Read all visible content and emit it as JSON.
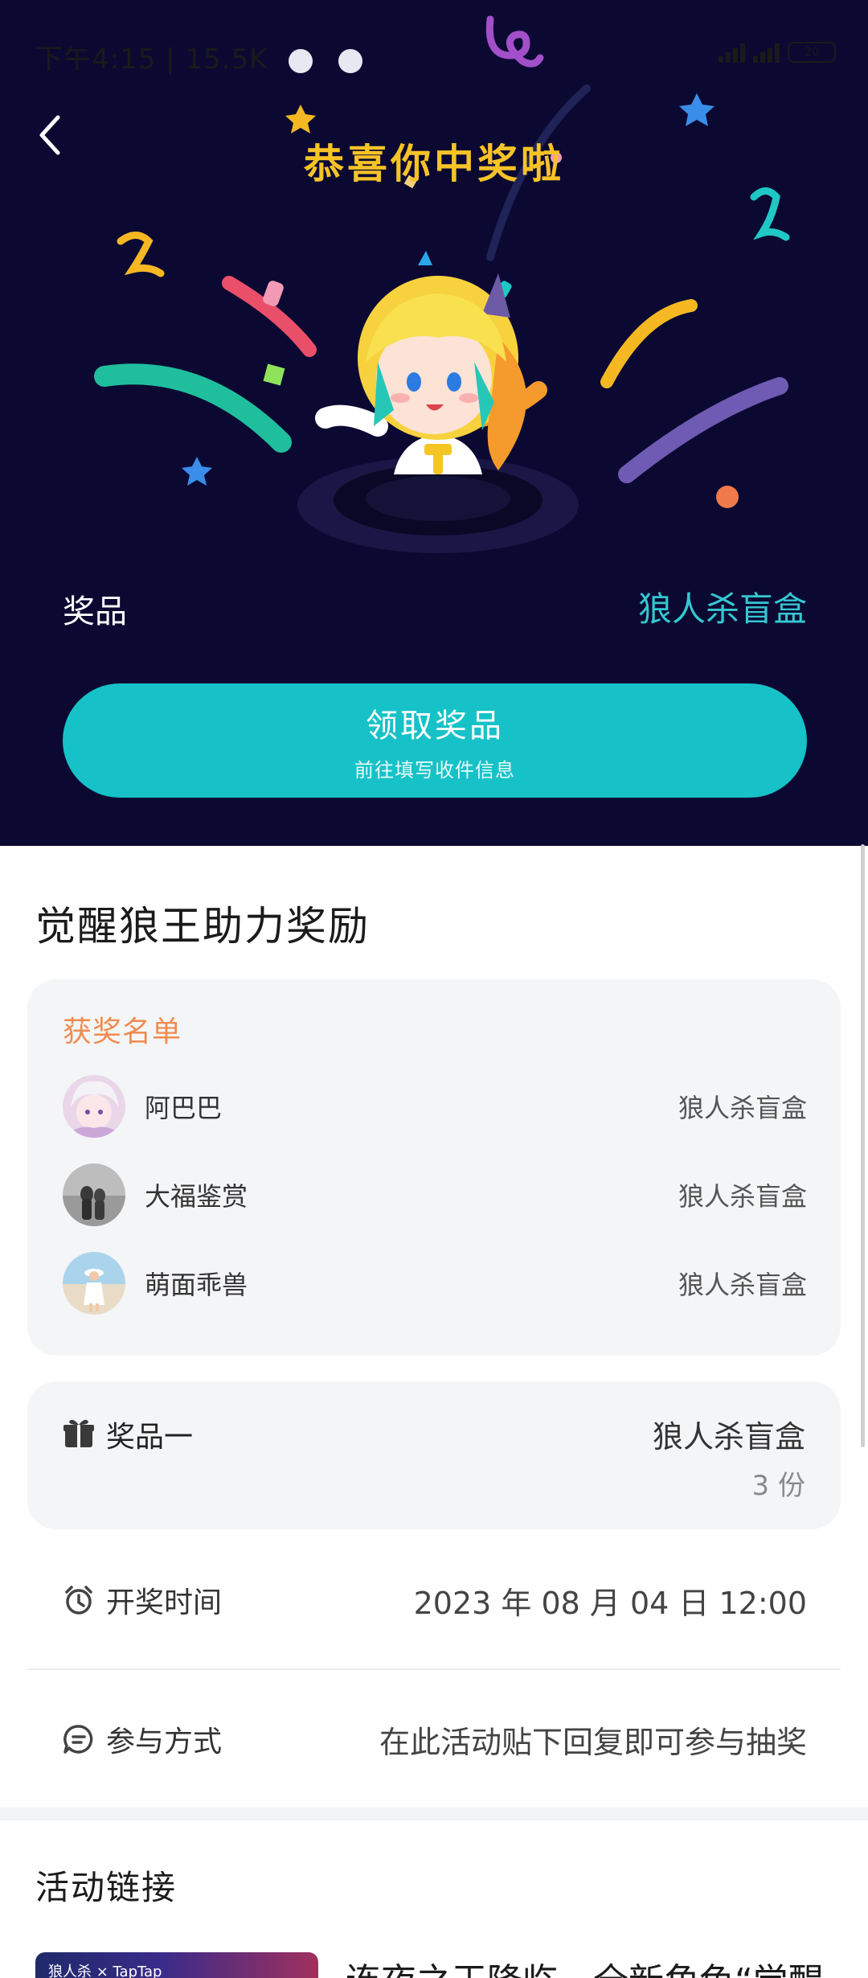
{
  "status_bar": {
    "time": "下午4:15 | 15.5K",
    "battery": "20"
  },
  "header": {
    "title": "恭喜你中奖啦",
    "back_icon": "chevron-left-icon"
  },
  "prize": {
    "label": "奖品",
    "value": "狼人杀盲盒"
  },
  "claim_button": {
    "label": "领取奖品",
    "sub_label": "前往填写收件信息"
  },
  "activity": {
    "title": "觉醒狼王助力奖励"
  },
  "winners": {
    "heading": "获奖名单",
    "rows": [
      {
        "name": "阿巴巴",
        "prize": "狼人杀盲盒",
        "avatar": "avatar-anime-girl"
      },
      {
        "name": "大福鉴赏",
        "prize": "狼人杀盲盒",
        "avatar": "avatar-grey-photo"
      },
      {
        "name": "萌面乖兽",
        "prize": "狼人杀盲盒",
        "avatar": "avatar-beach-photo"
      }
    ]
  },
  "prize_one": {
    "label": "奖品一",
    "value": "狼人杀盲盒",
    "count": "3 份",
    "icon": "gift-icon"
  },
  "draw_time": {
    "label": "开奖时间",
    "value": "2023 年 08 月 04 日 12:00",
    "icon": "alarm-clock-icon"
  },
  "participation": {
    "label": "参与方式",
    "value": "在此活动贴下回复即可参与抽奖",
    "icon": "chat-bubble-icon"
  },
  "links": {
    "title": "活动链接",
    "item_title": "连夜之王降临，全新角色“觉醒",
    "thumb_text": "狼人杀 × TapTap"
  },
  "colors": {
    "hero_bg": "#0b0932",
    "title_yellow": "#f7c327",
    "accent_teal": "#16c2c7",
    "prize_teal": "#35c7d1",
    "winners_orange": "#ef8c4f"
  }
}
